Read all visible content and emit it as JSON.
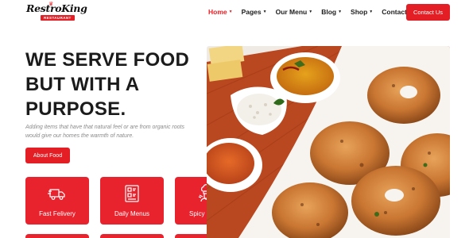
{
  "brand": {
    "name": "RestroKing",
    "tagline": "RESTAURANT"
  },
  "nav": {
    "items": [
      {
        "label": "Home",
        "active": true
      },
      {
        "label": "Pages",
        "active": false
      },
      {
        "label": "Our Menu",
        "active": false
      },
      {
        "label": "Blog",
        "active": false
      },
      {
        "label": "Shop",
        "active": false
      },
      {
        "label": "Contact Us",
        "active": false
      }
    ],
    "cta": "Contact Us"
  },
  "hero": {
    "headline_lines": [
      "WE SERVE FOOD",
      "BUT WITH A",
      "PURPOSE."
    ],
    "subtext": "Adding items that have that natural feel or are from organic roots would give our homes the warmth of nature.",
    "button": "About Food"
  },
  "features": [
    {
      "label": "Fast Felivery",
      "icon": "delivery-truck-icon"
    },
    {
      "label": "Daily Menus",
      "icon": "menu-list-icon"
    },
    {
      "label": "Spicy Foods",
      "icon": "chef-icon"
    }
  ],
  "colors": {
    "accent": "#e31e25",
    "card": "#e8232e",
    "heading": "#1b1b1b"
  }
}
